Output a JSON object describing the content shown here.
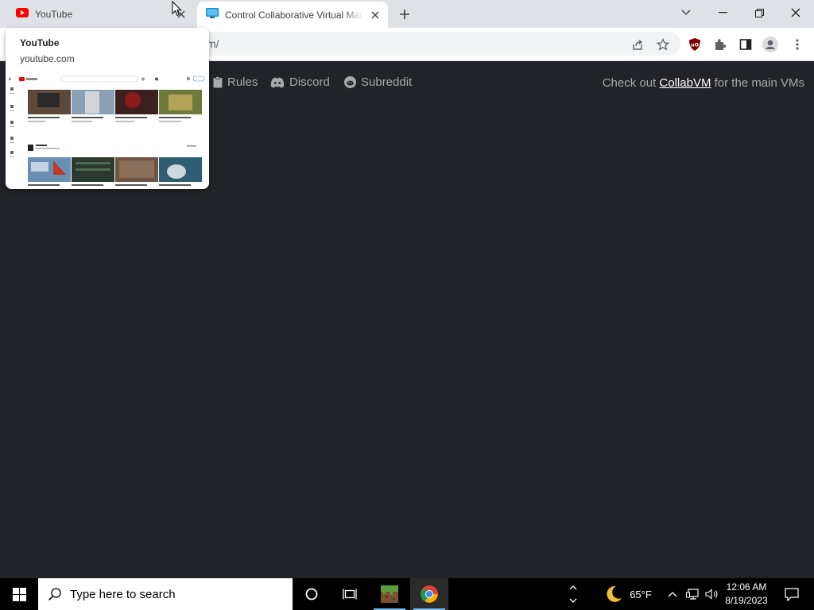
{
  "tabs": [
    {
      "title": "YouTube",
      "favicon": "youtube-icon",
      "active": false
    },
    {
      "title": "Control Collaborative Virtual Machines!",
      "favicon": "monitor-icon",
      "active": true
    }
  ],
  "toolbar": {
    "url_visible": "m/"
  },
  "hover_card": {
    "title": "YouTube",
    "domain": "youtube.com"
  },
  "page": {
    "nav": [
      {
        "label": "Rules",
        "icon": "clipboard-icon"
      },
      {
        "label": "Discord",
        "icon": "discord-icon"
      },
      {
        "label": "Subreddit",
        "icon": "reddit-icon"
      }
    ],
    "checkout_prefix": "Check out ",
    "checkout_link": "CollabVM",
    "checkout_suffix": " for the main VMs"
  },
  "taskbar": {
    "search_placeholder": "Type here to search",
    "weather": "65°F",
    "time": "12:06 AM",
    "date": "8/19/2023"
  },
  "colors": {
    "page_bg": "#212328",
    "tabstrip_bg": "#dee1e6",
    "youtube_red": "#ff0000",
    "ublock_red": "#800000"
  }
}
